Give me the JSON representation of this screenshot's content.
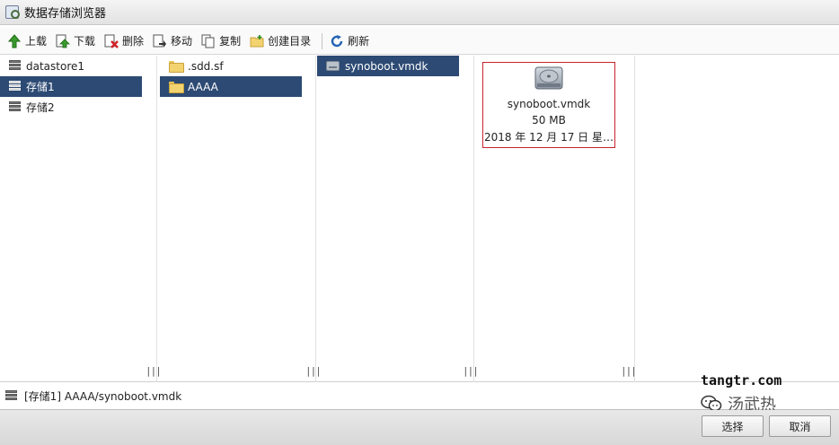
{
  "window": {
    "title": "数据存储浏览器"
  },
  "toolbar": {
    "buttons": [
      {
        "id": "upload",
        "label": "上载",
        "icon": "upload-arrow-icon"
      },
      {
        "id": "download",
        "label": "下载",
        "icon": "download-icon"
      },
      {
        "id": "delete",
        "label": "删除",
        "icon": "delete-icon"
      },
      {
        "id": "move",
        "label": "移动",
        "icon": "move-icon"
      },
      {
        "id": "copy",
        "label": "复制",
        "icon": "copy-icon"
      },
      {
        "id": "mkdir",
        "label": "创建目录",
        "icon": "new-folder-icon"
      },
      {
        "id": "refresh",
        "label": "刷新",
        "icon": "refresh-icon"
      }
    ]
  },
  "columns": {
    "datastores": [
      {
        "label": "datastore1",
        "selected": false
      },
      {
        "label": "存储1",
        "selected": true
      },
      {
        "label": "存储2",
        "selected": false
      }
    ],
    "folders": [
      {
        "label": ".sdd.sf",
        "selected": false
      },
      {
        "label": "AAAA",
        "selected": true
      }
    ],
    "files": [
      {
        "label": "synoboot.vmdk",
        "selected": true
      }
    ]
  },
  "detail": {
    "name": "synoboot.vmdk",
    "size": "50 MB",
    "date": "2018 年 12 月 17 日 星…"
  },
  "path": {
    "text": "[存储1] AAAA/synoboot.vmdk"
  },
  "footer": {
    "select_label": "选择",
    "cancel_label": "取消"
  },
  "watermark": {
    "site": "tangtr.com",
    "name": "汤武热"
  },
  "colors": {
    "selection": "#2c4a73",
    "highlight_border": "#c8242c"
  }
}
